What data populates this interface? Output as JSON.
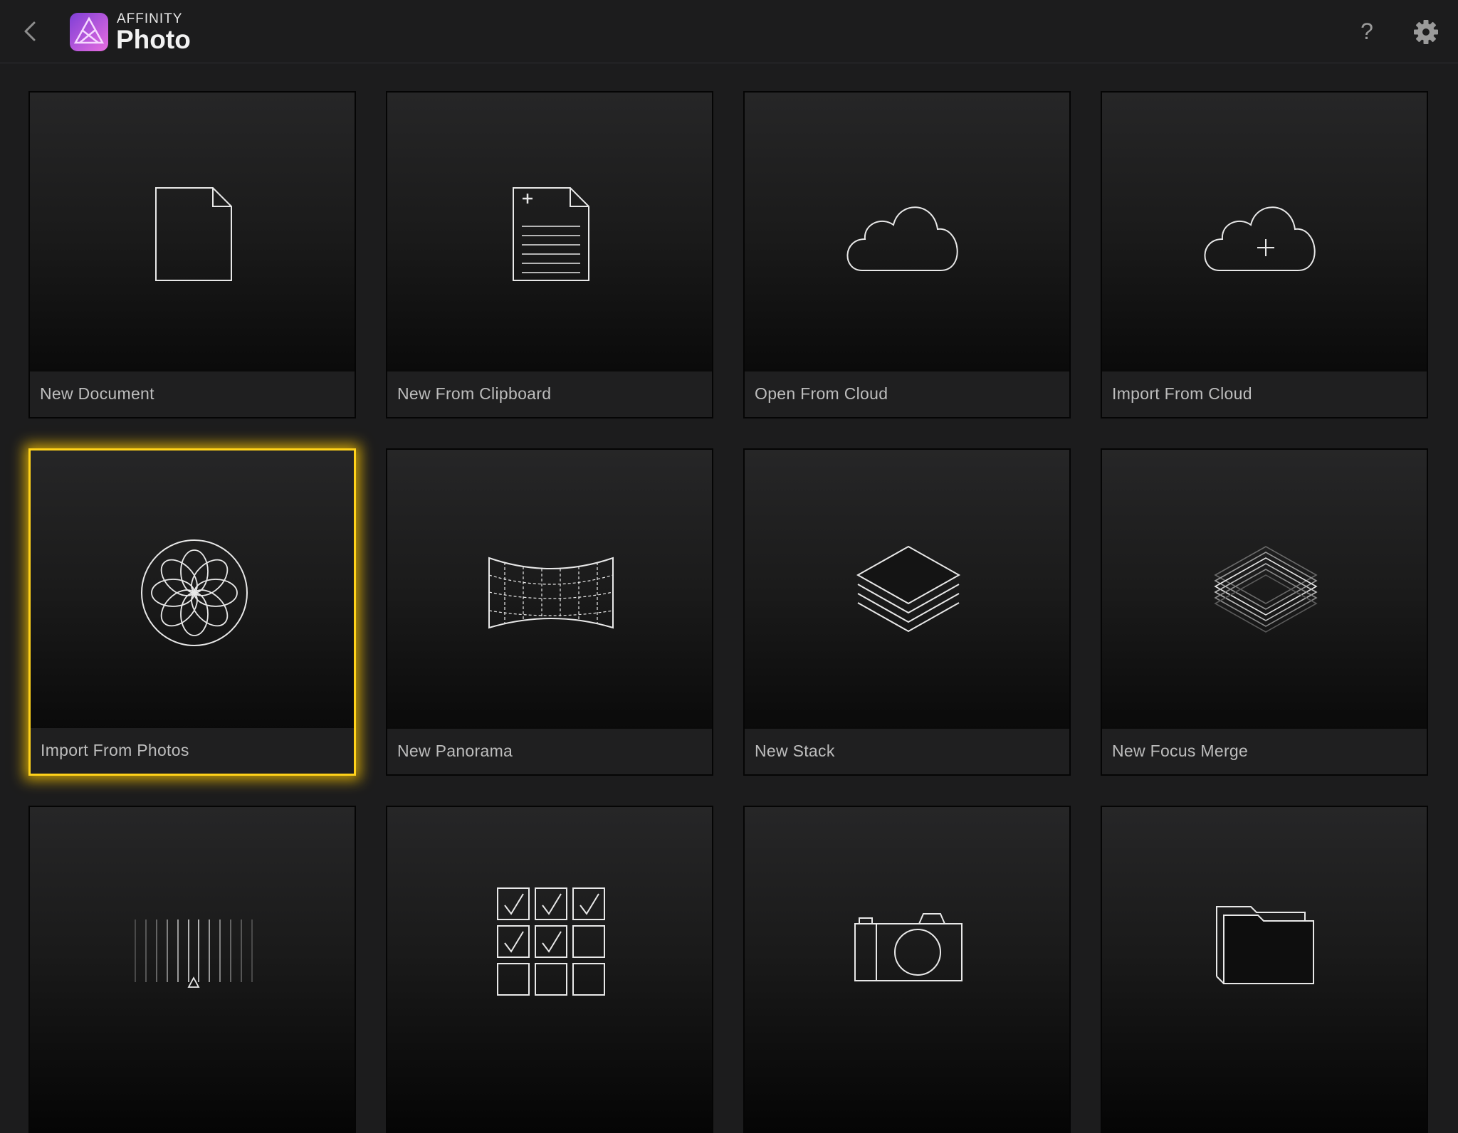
{
  "header": {
    "brand_small": "AFFINITY",
    "brand_large": "Photo",
    "help_label": "?"
  },
  "tiles": [
    {
      "label": "New Document",
      "icon": "document-icon"
    },
    {
      "label": "New From Clipboard",
      "icon": "clipboard-document-icon"
    },
    {
      "label": "Open From Cloud",
      "icon": "cloud-icon"
    },
    {
      "label": "Import From Cloud",
      "icon": "cloud-plus-icon"
    },
    {
      "label": "Import From Photos",
      "icon": "photos-flower-icon",
      "selected": true
    },
    {
      "label": "New Panorama",
      "icon": "panorama-icon"
    },
    {
      "label": "New Stack",
      "icon": "stack-layers-icon"
    },
    {
      "label": "New Focus Merge",
      "icon": "focus-merge-icon"
    },
    {
      "label": "",
      "icon": "hdr-slider-icon"
    },
    {
      "label": "",
      "icon": "checklist-grid-icon"
    },
    {
      "label": "",
      "icon": "camera-icon"
    },
    {
      "label": "",
      "icon": "folder-icon"
    }
  ],
  "colors": {
    "background": "#1c1c1d",
    "selection": "#ffd21a",
    "logo_accent": "#c95de8"
  }
}
